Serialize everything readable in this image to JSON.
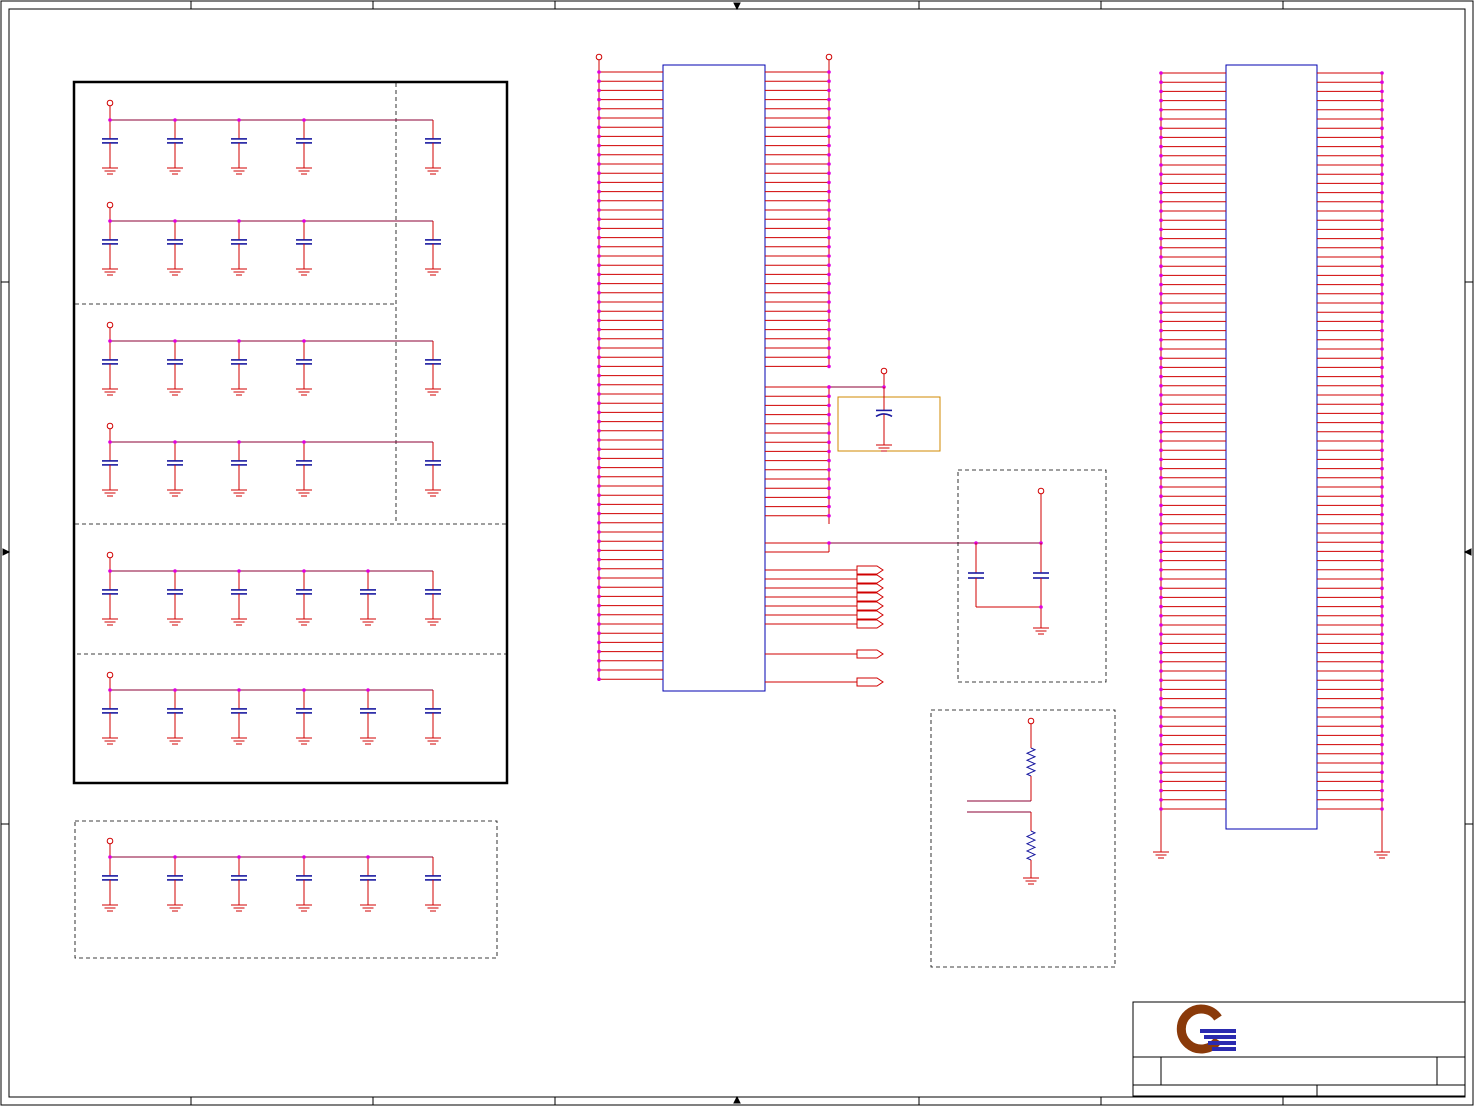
{
  "sheet": {
    "kind": "schematic-sheet",
    "colors": {
      "border": "#000000",
      "wire": "#d00000",
      "net": "#8b0036",
      "chip": "#0000b0",
      "junction": "#e000e0",
      "capacitor": "#1a1aa0",
      "group_box": "#d08a00",
      "logo_ring": "#8a3a0a",
      "logo_bars": "#2a2ab0"
    }
  },
  "icons": {
    "logo": "company-logo-icon",
    "capacitor": "capacitor-icon",
    "ground": "ground-icon",
    "power": "power-port-icon",
    "resistor": "resistor-icon",
    "offpage": "offpage-connector-icon"
  }
}
